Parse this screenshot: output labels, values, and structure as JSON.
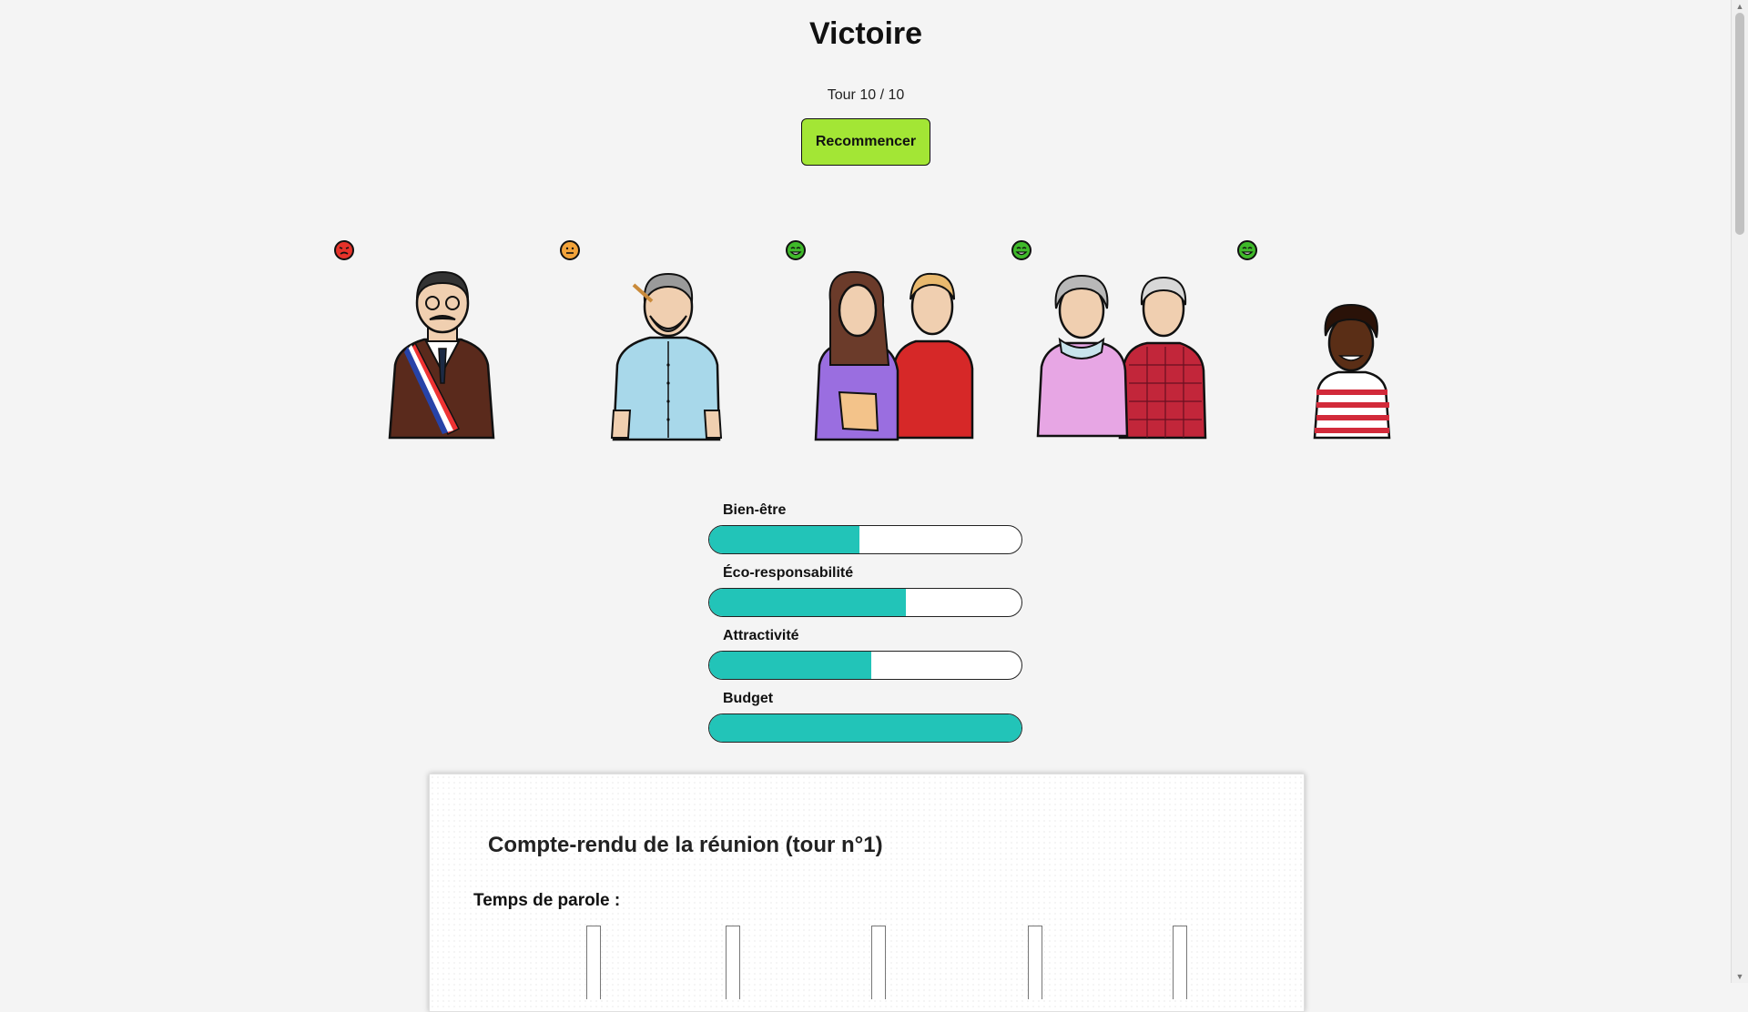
{
  "header": {
    "title": "Victoire",
    "turn": "Tour 10 / 10",
    "restart_label": "Recommencer"
  },
  "characters": [
    {
      "name": "Maire",
      "mood": "angry",
      "mood_color": "#e5332a"
    },
    {
      "name": "Artiste",
      "mood": "neutral",
      "mood_color": "#f2a33a"
    },
    {
      "name": "Couple",
      "mood": "happy",
      "mood_color": "#3fb92a"
    },
    {
      "name": "Retraités",
      "mood": "happy",
      "mood_color": "#3fb92a"
    },
    {
      "name": "Enfant",
      "mood": "happy",
      "mood_color": "#3fb92a"
    }
  ],
  "gauges": [
    {
      "label": "Bien-être",
      "value": 0.48
    },
    {
      "label": "Éco-responsabilité",
      "value": 0.63
    },
    {
      "label": "Attractivité",
      "value": 0.52
    },
    {
      "label": "Budget",
      "value": 1.0
    }
  ],
  "report": {
    "title": "Compte-rendu de la réunion (tour n°1)",
    "speaking_time_label": "Temps de parole :"
  },
  "colors": {
    "accent": "#a3e635",
    "gauge_fill": "#22c4b8"
  }
}
